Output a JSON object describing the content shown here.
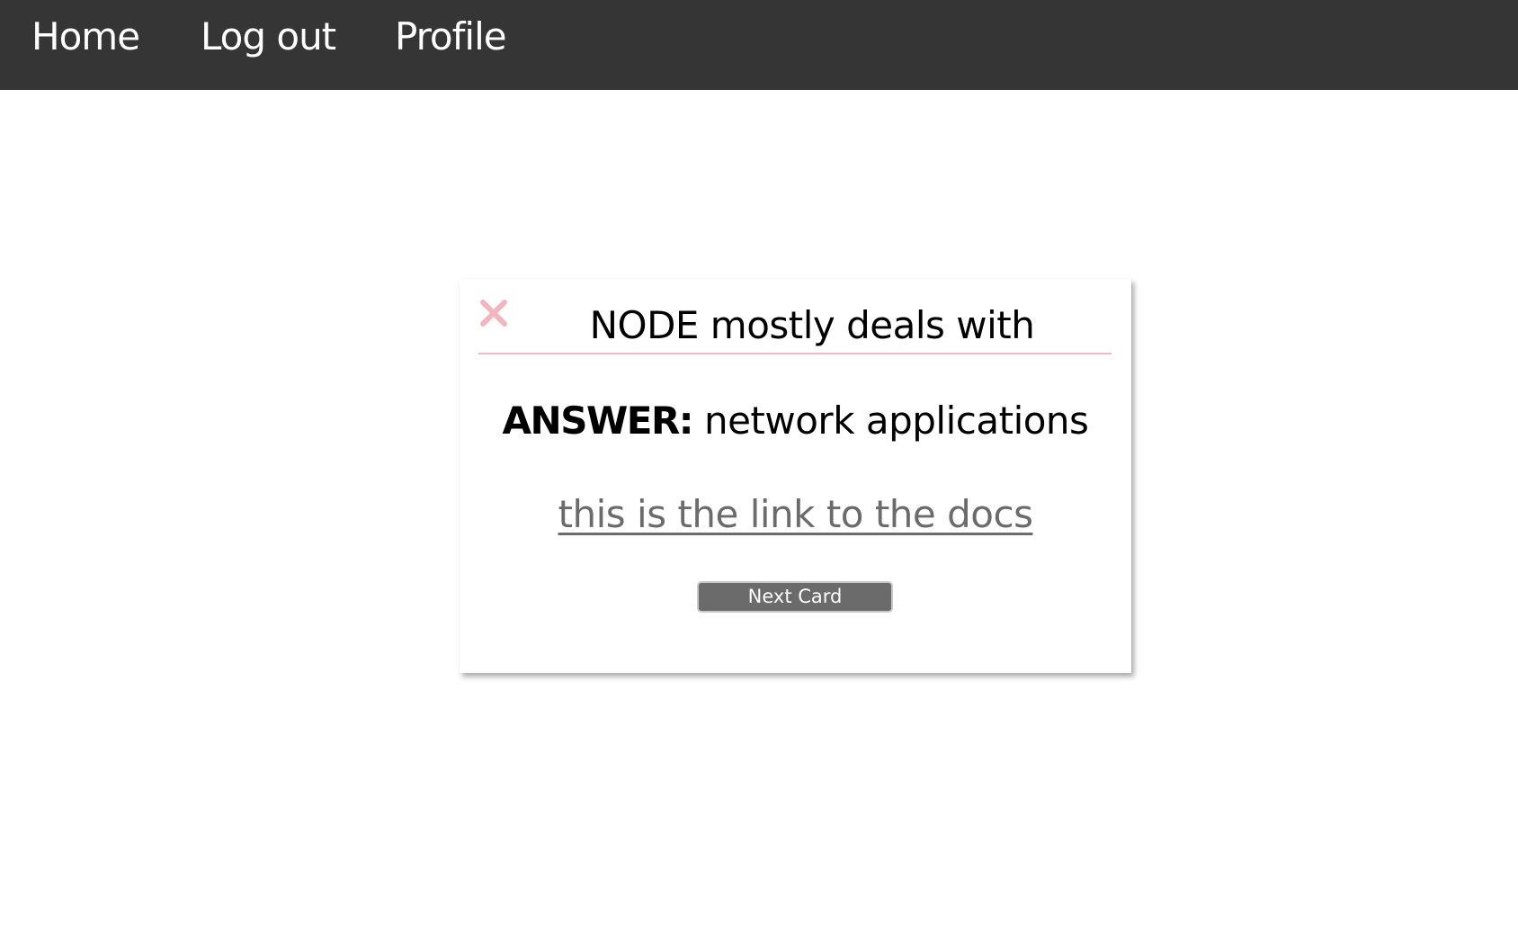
{
  "nav": {
    "items": [
      {
        "label": "Home"
      },
      {
        "label": "Log out"
      },
      {
        "label": "Profile"
      }
    ]
  },
  "card": {
    "close_icon": "close-icon",
    "question": "NODE mostly deals with",
    "answer_label": "ANSWER:",
    "answer_value": " network applications",
    "docs_link_text": "this is the link to the docs",
    "next_button_label": "Next Card"
  },
  "colors": {
    "nav_background": "#353535",
    "close_icon": "#f2b6bf",
    "divider": "#f4b8c1",
    "link": "#6b6b6b",
    "button": "#6b6b6b"
  }
}
